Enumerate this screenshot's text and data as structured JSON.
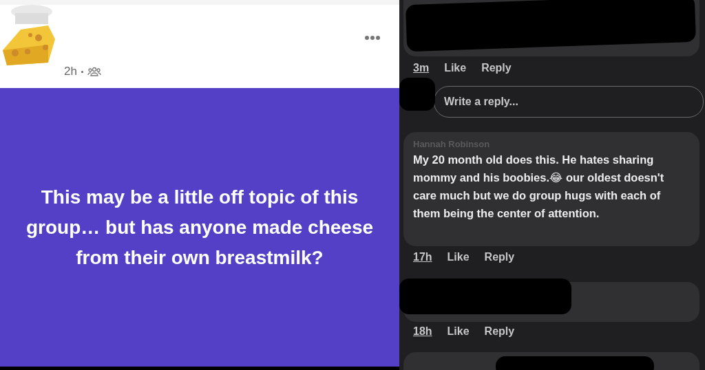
{
  "post": {
    "time": "2h",
    "text": "This may be a little off topic of this group… but has anyone made cheese from their own breastmilk?"
  },
  "comments": [
    {
      "kind": "redacted",
      "time": "3m",
      "like": "Like",
      "reply": "Reply"
    },
    {
      "kind": "reply_field",
      "placeholder": "Write a reply..."
    },
    {
      "kind": "comment",
      "author": "Hannah Robinson",
      "text": "My 20 month old does this. He hates sharing mommy and his boobies.😂 our oldest doesn't care much but we do group hugs with each of them being the center of attention.",
      "time": "17h",
      "like": "Like",
      "reply": "Reply"
    },
    {
      "kind": "redacted",
      "time": "18h",
      "like": "Like",
      "reply": "Reply"
    }
  ]
}
